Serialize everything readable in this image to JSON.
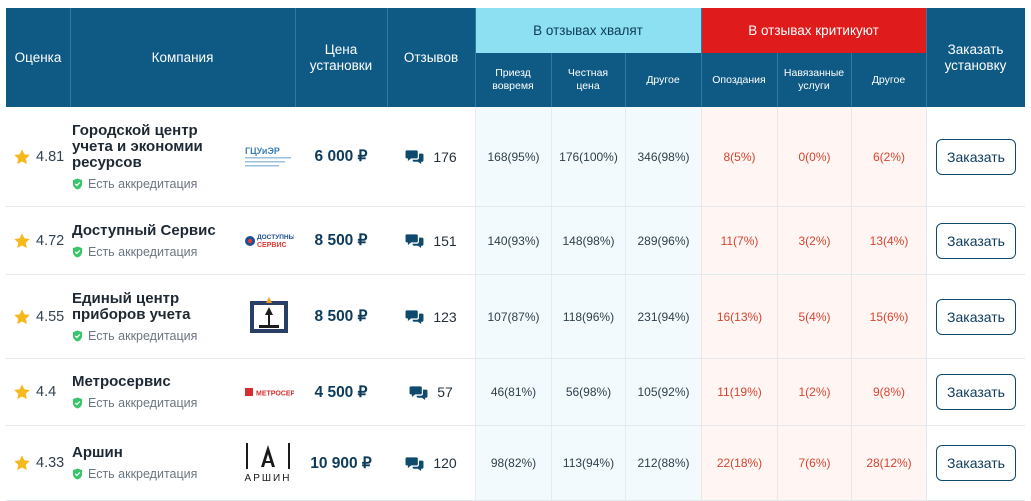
{
  "header": {
    "rating": "Оценка",
    "company": "Компания",
    "price": "Цена установки",
    "reviews": "Отзывов",
    "praise": "В отзывах хвалят",
    "criticize": "В отзывах критикуют",
    "order": "Заказать установку",
    "praise_cols": [
      "Приезд вовремя",
      "Честная цена",
      "Другое"
    ],
    "crit_cols": [
      "Опоздания",
      "Навязанные услуги",
      "Другое"
    ]
  },
  "accreditation_label": "Есть аккредитация",
  "order_button_label": "Заказать",
  "colors": {
    "header_bg": "#0e5a84",
    "praise_header_bg": "#8ce0f2",
    "criticize_header_bg": "#e01b1b",
    "star": "#f5b91c",
    "shield": "#3cc46a",
    "crit_text": "#d6442e"
  },
  "rows": [
    {
      "rating": "4.81",
      "company": "Городской центр учета и экономии ресурсов",
      "logo_text": "ГЦУиЭР",
      "logo_icon": "gcuer-logo",
      "price": "6 000 ₽",
      "reviews": "176",
      "praise": [
        "168(95%)",
        "176(100%)",
        "346(98%)"
      ],
      "crit": [
        "8(5%)",
        "0(0%)",
        "6(2%)"
      ]
    },
    {
      "rating": "4.72",
      "company": "Доступный Сервис",
      "logo_text": "ДОСТУПНЫЙ СЕРВИС",
      "logo_icon": "dostupny-servis-logo",
      "price": "8 500 ₽",
      "reviews": "151",
      "praise": [
        "140(93%)",
        "148(98%)",
        "289(96%)"
      ],
      "crit": [
        "11(7%)",
        "3(2%)",
        "13(4%)"
      ]
    },
    {
      "rating": "4.55",
      "company": "Единый центр приборов учета",
      "logo_text": "",
      "logo_icon": "edinyi-centr-logo",
      "price": "8 500 ₽",
      "reviews": "123",
      "praise": [
        "107(87%)",
        "118(96%)",
        "231(94%)"
      ],
      "crit": [
        "16(13%)",
        "5(4%)",
        "15(6%)"
      ]
    },
    {
      "rating": "4.4",
      "company": "Метросервис",
      "logo_text": "МЕТРОСЕРВИС",
      "logo_icon": "metroservis-logo",
      "price": "4 500 ₽",
      "reviews": "57",
      "praise": [
        "46(81%)",
        "56(98%)",
        "105(92%)"
      ],
      "crit": [
        "11(19%)",
        "1(2%)",
        "9(8%)"
      ]
    },
    {
      "rating": "4.33",
      "company": "Аршин",
      "logo_text": "АРШИН",
      "logo_icon": "arshin-logo",
      "price": "10 900 ₽",
      "reviews": "120",
      "praise": [
        "98(82%)",
        "113(94%)",
        "212(88%)"
      ],
      "crit": [
        "22(18%)",
        "7(6%)",
        "28(12%)"
      ]
    }
  ]
}
